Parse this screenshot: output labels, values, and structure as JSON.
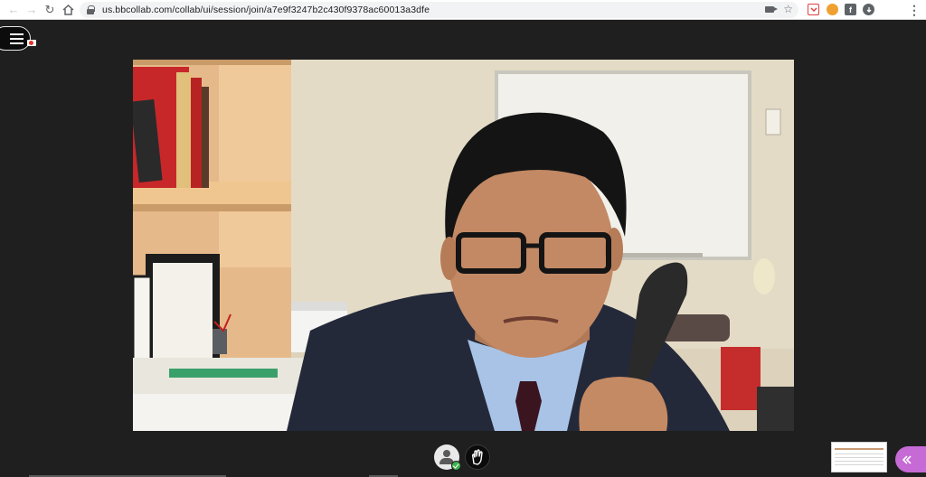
{
  "browser": {
    "url": "us.bbcollab.com/collab/ui/session/join/a7e9f3247b2c430f9378ac60013a3dfe",
    "back_icon": "arrow-left-icon",
    "forward_icon": "arrow-right-icon",
    "reload_icon": "reload-icon",
    "home_icon": "home-icon",
    "camera_icon": "camera-icon",
    "star_icon": "star-icon",
    "extensions": [
      "pocket-icon",
      "cookie-icon",
      "facebook-icon",
      "download-icon"
    ],
    "menu_icon": "kebab-menu-icon"
  },
  "session": {
    "menu_icon": "hamburger-icon",
    "recording_icon": "recording-icon",
    "video_description_icon": "participant-video"
  },
  "controls": {
    "my_status_icon": "avatar-status-icon",
    "raise_hand_icon": "raise-hand-icon",
    "open_panel_icon": "double-chevron-left-icon"
  },
  "colors": {
    "stage_bg": "#1f1f1f",
    "accent": "#c66ad6",
    "status_ok": "#3fb34f"
  }
}
